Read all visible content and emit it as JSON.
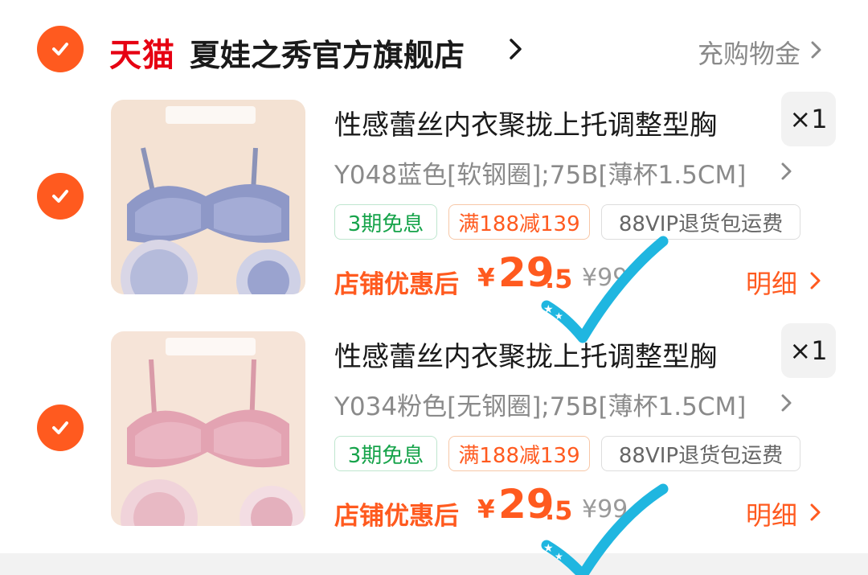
{
  "store": {
    "logo_text": "天猫",
    "name": "夏娃之秀官方旗舰店",
    "right_action": "充购物金"
  },
  "items": [
    {
      "title": "性感蕾丝内衣聚拢上托调整型胸",
      "quantity": "×1",
      "sku": "Y048蓝色[软钢圈];75B[薄杯1.5CM]",
      "tags": [
        "3期免息",
        "满188减139",
        "88VIP退货包运费"
      ],
      "price_label": "店铺优惠后",
      "currency": "¥",
      "price_int": "29",
      "price_dec": ".5",
      "original_price": "¥99",
      "detail_label": "明细",
      "image_color": "blue"
    },
    {
      "title": "性感蕾丝内衣聚拢上托调整型胸",
      "quantity": "×1",
      "sku": "Y034粉色[无钢圈];75B[薄杯1.5CM]",
      "tags": [
        "3期免息",
        "满188减139",
        "88VIP退货包运费"
      ],
      "price_label": "店铺优惠后",
      "currency": "¥",
      "price_int": "29",
      "price_dec": ".5",
      "original_price": "¥99",
      "detail_label": "明细",
      "image_color": "pink"
    }
  ],
  "colors": {
    "accent": "#ff5a1f",
    "tmall_red": "#e60012",
    "annotation_blue": "#1fb6e0"
  }
}
